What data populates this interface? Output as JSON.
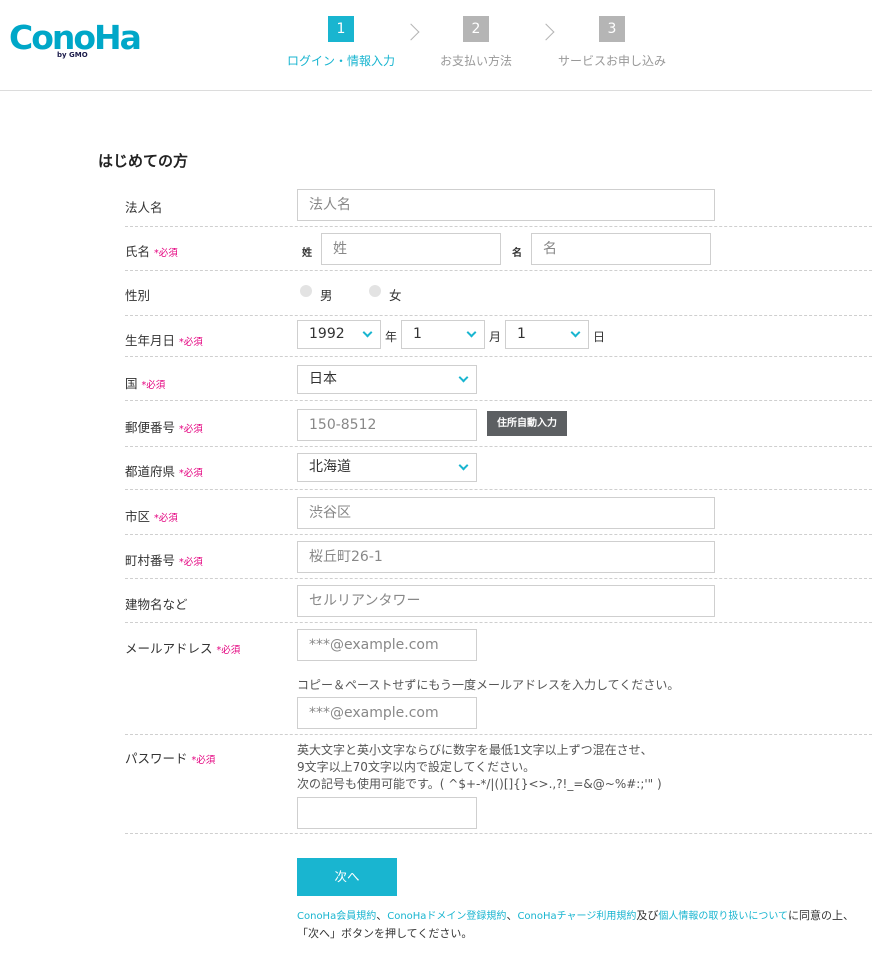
{
  "header": {
    "logo_text": "ConoHa",
    "logo_sub": "by GMO",
    "steps": [
      {
        "num": "1",
        "label": "ログイン・情報入力"
      },
      {
        "num": "2",
        "label": "お支払い方法"
      },
      {
        "num": "3",
        "label": "サービスお申し込み"
      }
    ]
  },
  "form": {
    "title": "はじめての方",
    "required_mark": "*必須",
    "corp_name": {
      "label": "法人名",
      "placeholder": "法人名"
    },
    "name": {
      "label": "氏名",
      "last_tag": "姓",
      "last_placeholder": "姓",
      "first_tag": "名",
      "first_placeholder": "名"
    },
    "gender": {
      "label": "性別",
      "male": "男",
      "female": "女"
    },
    "birth": {
      "label": "生年月日",
      "year": "1992",
      "year_unit": "年",
      "month": "1",
      "month_unit": "月",
      "day": "1",
      "day_unit": "日"
    },
    "country": {
      "label": "国",
      "value": "日本"
    },
    "postal": {
      "label": "郵便番号",
      "placeholder": "150-8512",
      "auto_button": "住所自動入力"
    },
    "prefecture": {
      "label": "都道府県",
      "value": "北海道"
    },
    "city": {
      "label": "市区",
      "placeholder": "渋谷区"
    },
    "town": {
      "label": "町村番号",
      "placeholder": "桜丘町26-1"
    },
    "building": {
      "label": "建物名など",
      "placeholder": "セルリアンタワー"
    },
    "email": {
      "label": "メールアドレス",
      "placeholder": "***@example.com",
      "confirm_note": "コピー＆ペーストせずにもう一度メールアドレスを入力してください。",
      "confirm_placeholder": "***@example.com"
    },
    "password": {
      "label": "パスワード",
      "note_1": "英大文字と英小文字ならびに数字を最低1文字以上ずつ混在させ、",
      "note_2": "9文字以上70文字以内で設定してください。",
      "note_3": "次の記号も使用可能です。( ^$+-*/|()[]{}<>.,?!_=&@~%#:;'\" )"
    },
    "next_button": "次へ",
    "terms": {
      "link_1": "ConoHa会員規約",
      "sep_1": "、",
      "link_2": "ConoHaドメイン登録規約",
      "sep_2": "、",
      "link_3": "ConoHaチャージ利用規約",
      "and": "及び",
      "link_4": "個人情報の取り扱いについて",
      "agree": "に同意の上、",
      "line_2": "「次へ」ボタンを押してください。"
    }
  },
  "colors": {
    "accent": "#19b5d0",
    "required": "#e4007f",
    "dark_button": "#5c5f62"
  }
}
